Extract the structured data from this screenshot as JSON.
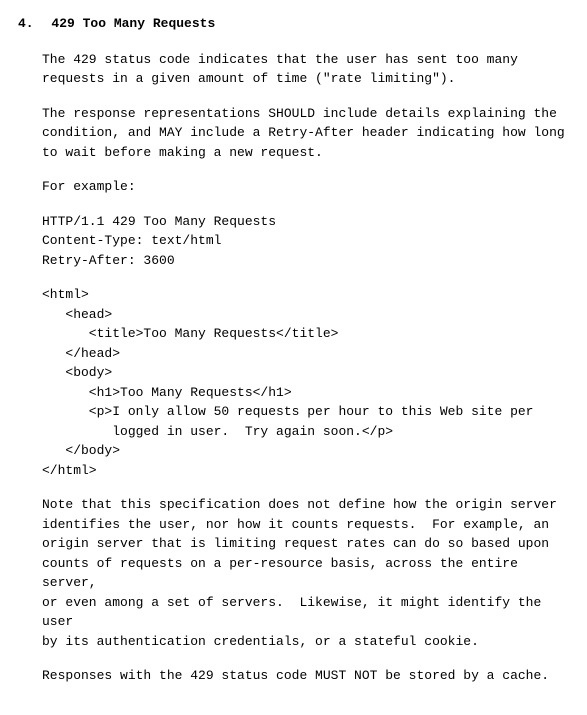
{
  "section": {
    "number": "4.",
    "title": "429 Too Many Requests"
  },
  "paragraphs": {
    "p1": "The 429 status code indicates that the user has sent too many\nrequests in a given amount of time (\"rate limiting\").",
    "p2": "The response representations SHOULD include details explaining the\ncondition, and MAY include a Retry-After header indicating how long\nto wait before making a new request.",
    "p3": "For example:",
    "code1": "HTTP/1.1 429 Too Many Requests\nContent-Type: text/html\nRetry-After: 3600",
    "code2": "<html>\n   <head>\n      <title>Too Many Requests</title>\n   </head>\n   <body>\n      <h1>Too Many Requests</h1>\n      <p>I only allow 50 requests per hour to this Web site per\n         logged in user.  Try again soon.</p>\n   </body>\n</html>",
    "p4": "Note that this specification does not define how the origin server\nidentifies the user, nor how it counts requests.  For example, an\norigin server that is limiting request rates can do so based upon\ncounts of requests on a per-resource basis, across the entire server,\nor even among a set of servers.  Likewise, it might identify the user\nby its authentication credentials, or a stateful cookie.",
    "p5": "Responses with the 429 status code MUST NOT be stored by a cache."
  }
}
